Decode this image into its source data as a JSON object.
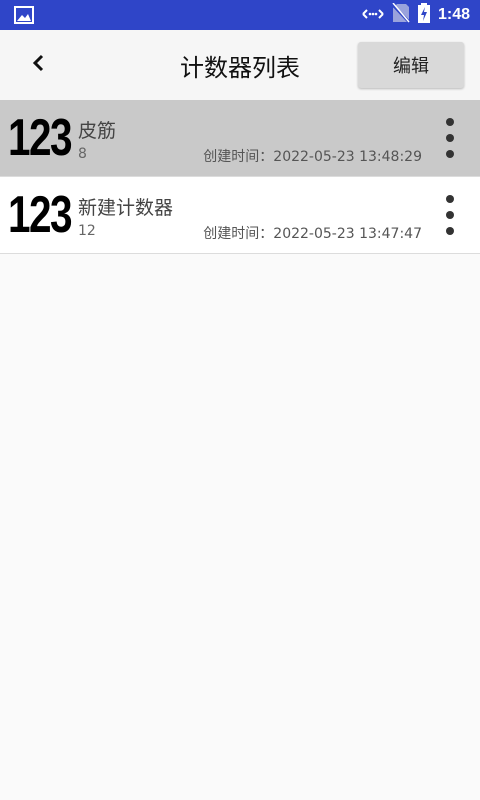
{
  "status_bar": {
    "time": "1:48",
    "icons": [
      "gallery-icon",
      "data-arrows-icon",
      "no-sim-icon",
      "battery-charging-icon"
    ]
  },
  "toolbar": {
    "title": "计数器列表",
    "edit_label": "编辑",
    "back_icon": "chevron-left-icon"
  },
  "counters": [
    {
      "icon_text": "123",
      "name": "皮筋",
      "count": "8",
      "created": "创建时间：2022-05-23 13:48:29",
      "selected": true
    },
    {
      "icon_text": "123",
      "name": "新建计数器",
      "count": "12",
      "created": "创建时间：2022-05-23 13:47:47",
      "selected": false
    }
  ],
  "colors": {
    "status_bar": "#2f45c8",
    "selected_row": "#c9c9c9",
    "edit_button": "#d9d9d9"
  }
}
